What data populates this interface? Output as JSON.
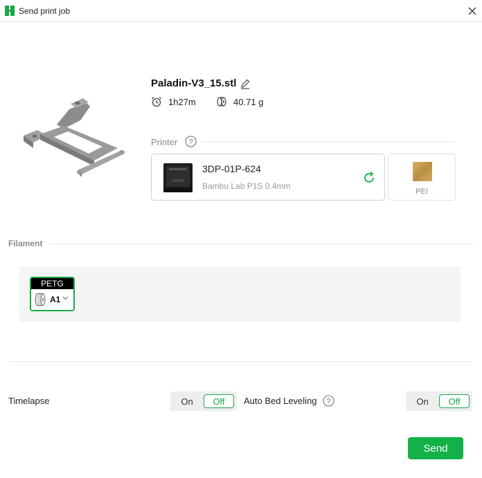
{
  "window": {
    "title": "Send print job"
  },
  "model": {
    "file_name": "Paladin-V3_15.stl",
    "print_time": "1h27m",
    "filament_weight": "40.71 g"
  },
  "printer_section": {
    "label": "Printer",
    "printer_name": "3DP-01P-624",
    "printer_model": "Bambu Lab P1S  0.4mm",
    "plate_label": "PEI"
  },
  "filament_section": {
    "label": "Filament",
    "slots": [
      {
        "type": "PETG",
        "name": "A1"
      }
    ]
  },
  "options": {
    "timelapse": {
      "label": "Timelapse",
      "on_label": "On",
      "off_label": "Off",
      "state": "off"
    },
    "auto_bed_leveling": {
      "label": "Auto Bed Leveling",
      "on_label": "On",
      "off_label": "Off",
      "state": "off"
    }
  },
  "actions": {
    "send_label": "Send"
  },
  "colors": {
    "accent": "#13b148",
    "selected_border": "#1aa84a",
    "plate_color": "#c9a35a"
  }
}
